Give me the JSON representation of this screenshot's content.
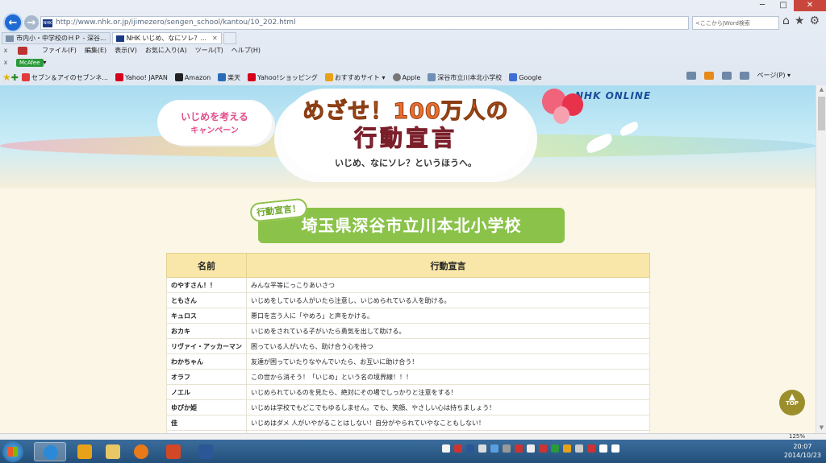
{
  "browser": {
    "url": "http://www.nhk.or.jp/ijimezero/sengen_school/kantou/10_202.html",
    "search_placeholder": "<ここからJWord検索",
    "tabs": [
      {
        "label": "市内小・中学校のＨＰ - 深谷...",
        "active": false
      },
      {
        "label": "NHK いじめ、なにソレ？...",
        "active": true
      }
    ],
    "menu": [
      "ファイル(F)",
      "編集(E)",
      "表示(V)",
      "お気に入り(A)",
      "ツール(T)",
      "ヘルプ(H)"
    ],
    "mcafee": "McAfee",
    "favorites": [
      {
        "label": "セブン＆アイのセブンネ...",
        "color": "#e23b3b"
      },
      {
        "label": "Yahoo! JAPAN",
        "color": "#d6001c"
      },
      {
        "label": "Amazon",
        "color": "#222222"
      },
      {
        "label": "楽天",
        "color": "#2a6bb8"
      },
      {
        "label": "Yahoo!ショッピング",
        "color": "#d6001c"
      },
      {
        "label": "おすすめサイト ▾",
        "color": "#e8a21a"
      },
      {
        "label": "Apple",
        "color": "#777777"
      },
      {
        "label": "深谷市立川本北小学校",
        "color": "#6f8fb6"
      },
      {
        "label": "Google",
        "color": "#3d6ed8"
      }
    ],
    "page_menu": "ページ(P) ▾",
    "zoom": "125%"
  },
  "page": {
    "campaign_line1": "いじめを考える",
    "campaign_line2": "キャンペーン",
    "headline1": "めざせ！100万人の",
    "headline2": "行動宣言",
    "tagline": "いじめ、なにソレ？というほうへ。",
    "brand": "NHK ONLINE",
    "tag": "行動宣言！",
    "school": "埼玉県深谷市立川本北小学校",
    "table_headers": [
      "名前",
      "行動宣言"
    ],
    "rows": [
      {
        "name": "のやすさん！！",
        "text": "みんな平等にっこりあいさつ"
      },
      {
        "name": "ともさん",
        "text": "いじめをしている人がいたら注意し、いじめられている人を助ける。"
      },
      {
        "name": "キュロス",
        "text": "悪口を言う人に「やめろ」と声をかける。"
      },
      {
        "name": "おカキ",
        "text": "いじめをされている子がいたら勇気を出して助ける。"
      },
      {
        "name": "リヴァイ・アッカーマン",
        "text": "困っている人がいたら、助け合う心を持つ"
      },
      {
        "name": "わかちゃん",
        "text": "友達が困っていたりなやんでいたら、お互いに助け合う！"
      },
      {
        "name": "オラフ",
        "text": "この世から消そう！「いじめ」という名の境界線！！！"
      },
      {
        "name": "ノエル",
        "text": "いじめられているのを見たら、絶対にその場でしっかりと注意をする！"
      },
      {
        "name": "ゆぴか姫",
        "text": "いじめは学校でもどこでもゆるしません。でも、笑顔、やさしい心は持ちましょう！"
      },
      {
        "name": "佳",
        "text": "いじめはダメ 人がいやがることはしない！自分がやられていやなこともしない！"
      },
      {
        "name": "",
        "text": ""
      }
    ],
    "top_label": "TOP"
  },
  "taskbar": {
    "time": "20:07",
    "date": "2014/10/23"
  },
  "colors": {
    "accent": "#1f6ad3",
    "school_band": "#8bc34a",
    "header_bg": "#f8e7a8",
    "headline_orange": "#ec6d2f",
    "headline_red": "#e23e57"
  }
}
